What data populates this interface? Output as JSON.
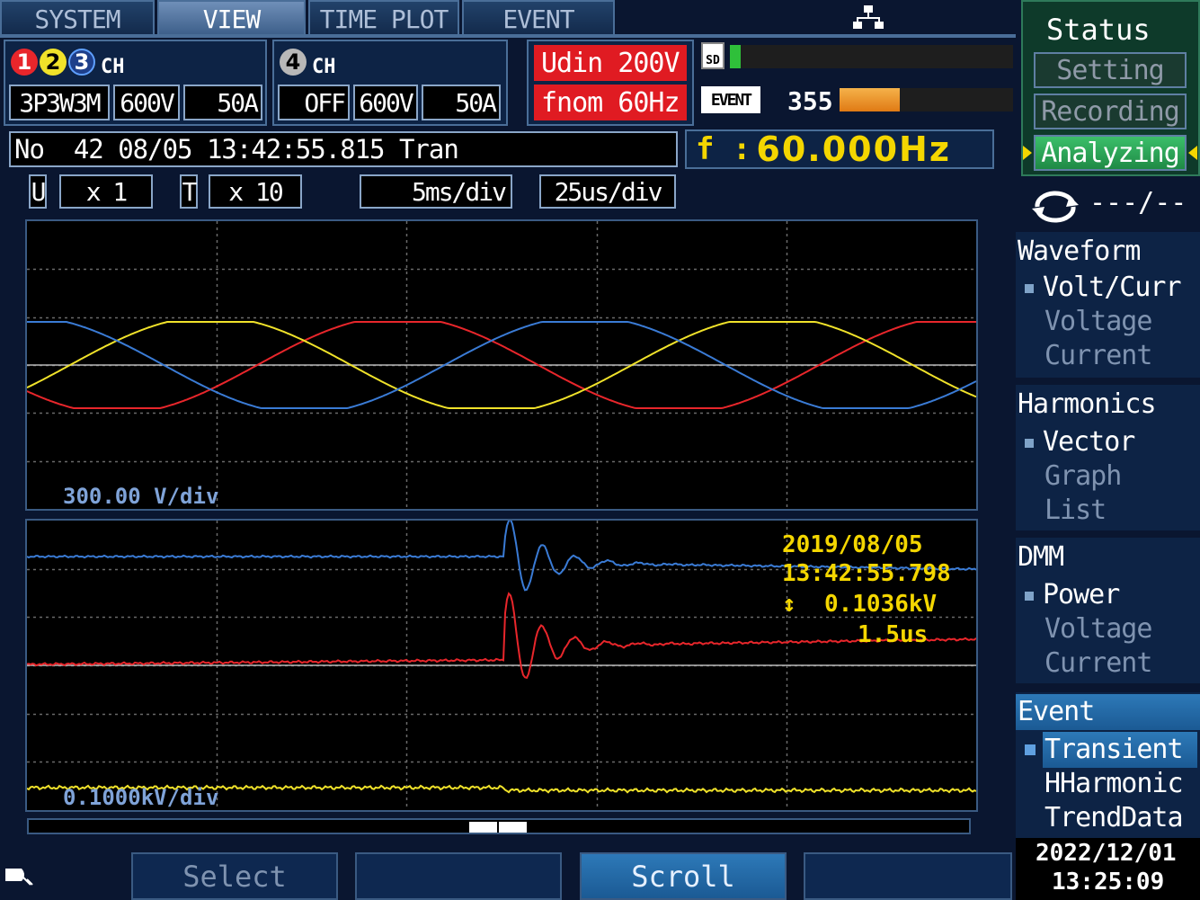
{
  "tabs": [
    {
      "label": "SYSTEM",
      "active": false
    },
    {
      "label": "VIEW",
      "active": true
    },
    {
      "label": "TIME PLOT",
      "active": false
    },
    {
      "label": "EVENT",
      "active": false
    }
  ],
  "ch123": {
    "label": "CH",
    "wiring": "3P3W3M",
    "voltage": "600V",
    "current": "50A"
  },
  "ch4": {
    "num": "4",
    "label": "CH",
    "wiring": "OFF",
    "voltage": "600V",
    "current": "50A"
  },
  "udin": "Udin 200V",
  "fnom": "fnom  60Hz",
  "event_count": "355",
  "sd_label": "SD",
  "event_label": "EVENT",
  "info_line": "No  42 08/05 13:42:55.815 Tran",
  "freq": {
    "label": "f :",
    "value": "60.000Hz"
  },
  "scale": {
    "u_label": "U",
    "u_value": "x 1",
    "t_label": "T",
    "t_value": "x 10",
    "time_div_1": "5ms/div",
    "time_div_2": "25us/div"
  },
  "upper_graph": {
    "scale_label": "300.00 V/div"
  },
  "lower_graph": {
    "scale_label": "0.1000kV/div",
    "date": "2019/08/05",
    "time": "13:42:55.798",
    "peak": "↕  0.1036kV",
    "width": "1.5us"
  },
  "status_panel": {
    "title": "Status",
    "setting": "Setting",
    "recording": "Recording",
    "analyzing": "Analyzing",
    "rotation": "---/---"
  },
  "menu": {
    "waveform": {
      "title": "Waveform",
      "items": [
        "Volt/Curr",
        "Voltage",
        "Current"
      ]
    },
    "harmonics": {
      "title": "Harmonics",
      "items": [
        "Vector",
        "Graph",
        "List"
      ]
    },
    "dmm": {
      "title": "DMM",
      "items": [
        "Power",
        "Voltage",
        "Current"
      ]
    },
    "event": {
      "title": "Event",
      "items": [
        "Transient",
        "HHarmonic",
        "TrendData"
      ]
    }
  },
  "fkeys": [
    "Select",
    "",
    "Scroll",
    ""
  ],
  "clock": {
    "date": "2022/12/01",
    "time": "13:25:09"
  },
  "colors": {
    "ch1": "#e8262b",
    "ch2": "#f0e22a",
    "ch3": "#3a7bd5",
    "accent": "#f4d600",
    "active_tab": "#5a7fab"
  }
}
